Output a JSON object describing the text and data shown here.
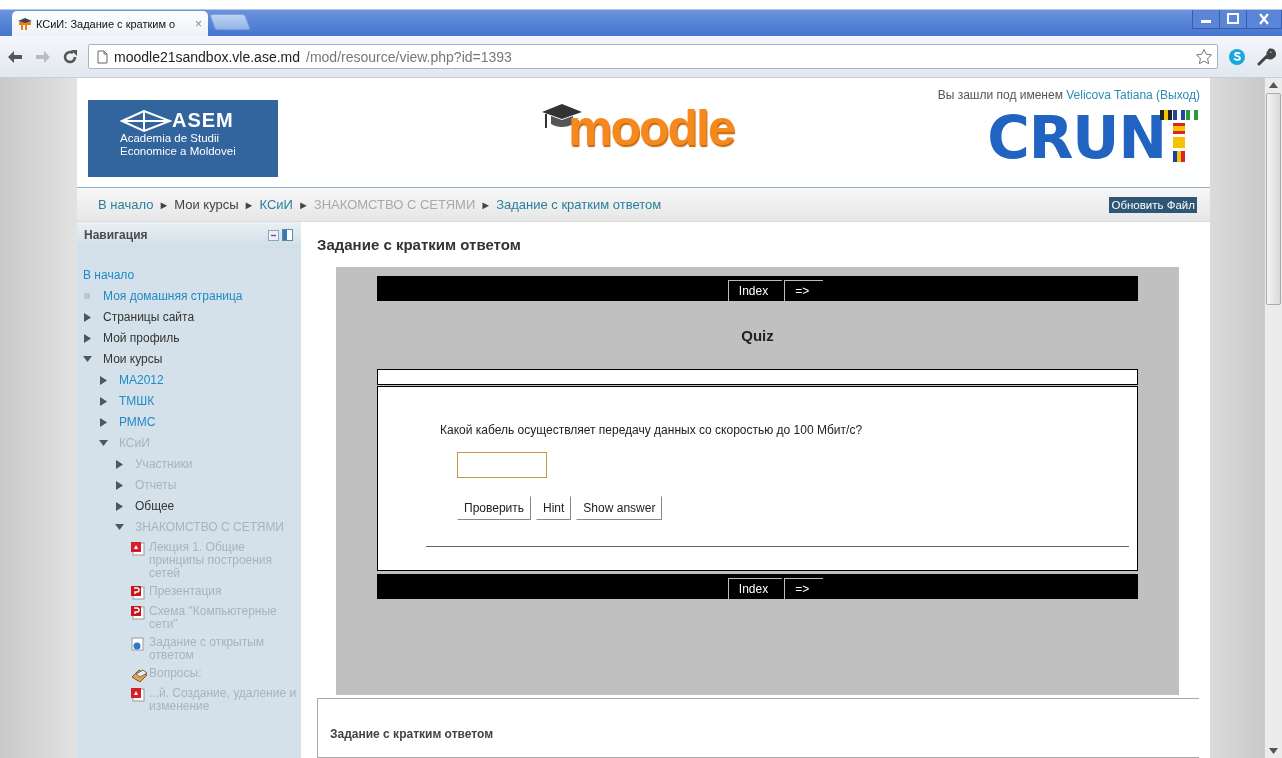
{
  "browser": {
    "tab": {
      "title": "КСиИ: Задание с кратким о",
      "close": "×"
    },
    "address": {
      "host": "moodle21sandbox.vle.ase.md",
      "path": "/mod/resource/view.php?id=1393"
    }
  },
  "header": {
    "asem_logo": {
      "mark": "ASEM",
      "lines": [
        "Academia de Studii",
        "Economice a Moldovei"
      ]
    },
    "moodle_logo": "moodle",
    "login": {
      "prefix": "Вы зашли под именем",
      "user": "Velicova Tatiana",
      "logout": "(Выход)"
    },
    "crun_logo": "CRUN"
  },
  "breadcrumb": {
    "items": [
      {
        "label": "В начало",
        "kind": "link"
      },
      {
        "separator": "►",
        "label": "Мои курсы",
        "kind": "plain"
      },
      {
        "separator": "►",
        "label": "КСиИ",
        "kind": "link"
      },
      {
        "separator": "►",
        "label": "ЗНАКОМСТВО С СЕТЯМИ",
        "kind": "dimmed"
      },
      {
        "separator": "►",
        "label": "Задание с кратким ответом",
        "kind": "link"
      }
    ],
    "button": "Обновить Файл"
  },
  "navigation": {
    "title": "Навигация",
    "items": [
      {
        "label": "В начало",
        "kind": "root",
        "dimmed": false
      },
      {
        "label": "Моя домашняя страница",
        "kind": "page",
        "dimmed": false
      },
      {
        "label": "Страницы сайта",
        "kind": "category",
        "dimmed": false,
        "expanded": false
      },
      {
        "label": "Мой профиль",
        "kind": "category",
        "dimmed": false,
        "expanded": false
      },
      {
        "label": "Мои курсы",
        "kind": "category",
        "dimmed": false,
        "expanded": true,
        "children": [
          {
            "label": "MA2012",
            "kind": "course",
            "dimmed": false,
            "expanded": false
          },
          {
            "label": "ТМШК",
            "kind": "course",
            "dimmed": false,
            "expanded": false
          },
          {
            "label": "РММС",
            "kind": "course",
            "dimmed": false,
            "expanded": false
          },
          {
            "label": "КСиИ",
            "kind": "course",
            "dimmed": true,
            "expanded": true,
            "children": [
              {
                "label": "Участники",
                "kind": "category",
                "dimmed": true,
                "expanded": false
              },
              {
                "label": "Отчеты",
                "kind": "category",
                "dimmed": true,
                "expanded": false
              },
              {
                "label": "Общее",
                "kind": "category",
                "dimmed": false,
                "expanded": false
              },
              {
                "label": "ЗНАКОМСТВО С СЕТЯМИ",
                "kind": "category",
                "dimmed": true,
                "expanded": true,
                "children": [
                  {
                    "label": "Лекция 1. Общие принципы построения сетей",
                    "kind": "pdf",
                    "dimmed": true
                  },
                  {
                    "label": "Презентация",
                    "kind": "slides",
                    "dimmed": true
                  },
                  {
                    "label": "Схема \"Компьютерные сети\"",
                    "kind": "slides",
                    "dimmed": true
                  },
                  {
                    "label": "Задание с открытым ответом",
                    "kind": "assignment",
                    "dimmed": true
                  },
                  {
                    "label": "Вопросы:",
                    "kind": "quiz",
                    "dimmed": true
                  },
                  {
                    "label": "...й. Создание, удаление и изменение",
                    "kind": "pdf",
                    "dimmed": true
                  }
                ]
              }
            ]
          }
        ]
      }
    ]
  },
  "main": {
    "title": "Задание с кратким ответом",
    "quiz": {
      "nav_top": [
        "Index",
        "=>"
      ],
      "title": "Quiz",
      "question": "Какой кабель осуществляет передачу данных со скоростью до 100 Мбит/с?",
      "buttons": [
        "Проверить",
        "Hint",
        "Show answer"
      ],
      "nav_bottom": [
        "Index",
        "=>"
      ]
    },
    "lower_title": "Задание с кратким ответом"
  }
}
